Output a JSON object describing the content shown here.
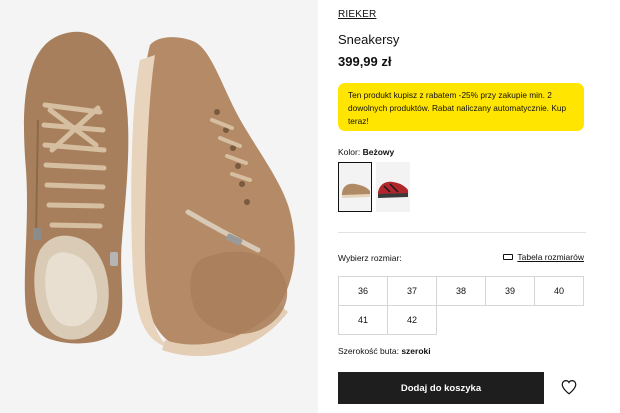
{
  "product": {
    "brand": "RIEKER",
    "name": "Sneakersy",
    "price": "399,99 zł",
    "promo_text": "Ten produkt kupisz z rabatem -25% przy zakupie min. 2 dowolnych produktów. Rabat naliczany automatycznie. Kup teraz!"
  },
  "color": {
    "label": "Kolor:",
    "value": "Beżowy",
    "swatches": [
      {
        "name": "beige",
        "selected": true,
        "color": "#b08a64"
      },
      {
        "name": "red",
        "selected": false,
        "color": "#b0262c"
      }
    ]
  },
  "sizes": {
    "label": "Wybierz rozmiar:",
    "guide_label": "Tabela rozmiarów",
    "options": [
      "36",
      "37",
      "38",
      "39",
      "40",
      "41",
      "42"
    ]
  },
  "shoe_width": {
    "label": "Szerokość buta:",
    "value": "szeroki"
  },
  "actions": {
    "add_to_cart": "Dodaj do koszyka",
    "wishlist_icon": "heart-icon"
  },
  "colors": {
    "promo_bg": "#ffe500",
    "button_bg": "#1e1e1e",
    "gallery_bg": "#f4f4f4"
  }
}
